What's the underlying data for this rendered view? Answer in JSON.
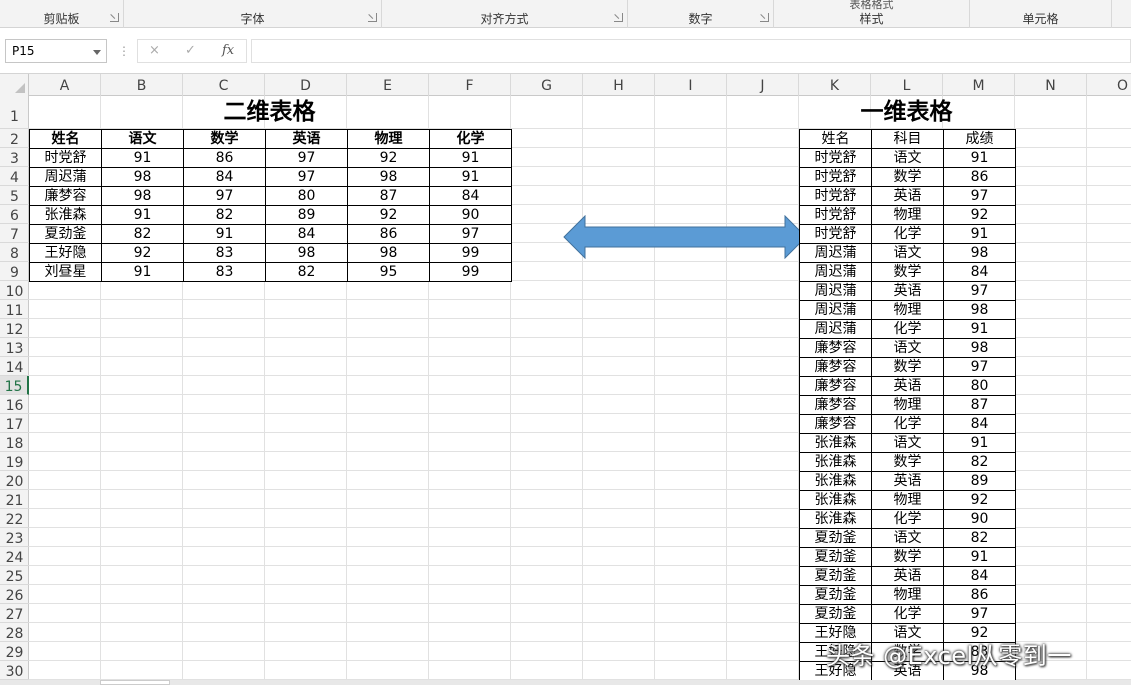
{
  "ribbon": {
    "groups": [
      {
        "label": "剪贴板"
      },
      {
        "label": "字体"
      },
      {
        "label": "对齐方式"
      },
      {
        "label": "数字"
      },
      {
        "label": "样式",
        "clipped_top": "表格格式"
      },
      {
        "label": "单元格"
      }
    ]
  },
  "formula_bar": {
    "name_box": "P15",
    "cancel_icon": "×",
    "enter_icon": "✓",
    "fx_label": "fx",
    "formula_value": ""
  },
  "sheet": {
    "columns": [
      "A",
      "B",
      "C",
      "D",
      "E",
      "F",
      "G",
      "H",
      "I",
      "J",
      "K",
      "L",
      "M",
      "N",
      "O"
    ],
    "rows": [
      "1",
      "2",
      "3",
      "4",
      "5",
      "6",
      "7",
      "8",
      "9",
      "10",
      "11",
      "12",
      "13",
      "14",
      "15",
      "16",
      "17",
      "18",
      "19",
      "20",
      "21",
      "22",
      "23",
      "24",
      "25",
      "26",
      "27",
      "28",
      "29",
      "30"
    ],
    "active_row": "15"
  },
  "table2d": {
    "title": "二维表格",
    "headers": [
      "姓名",
      "语文",
      "数学",
      "英语",
      "物理",
      "化学"
    ],
    "rows": [
      [
        "时党舒",
        "91",
        "86",
        "97",
        "92",
        "91"
      ],
      [
        "周迟蒲",
        "98",
        "84",
        "97",
        "98",
        "91"
      ],
      [
        "廉梦容",
        "98",
        "97",
        "80",
        "87",
        "84"
      ],
      [
        "张淮森",
        "91",
        "82",
        "89",
        "92",
        "90"
      ],
      [
        "夏劲釜",
        "82",
        "91",
        "84",
        "86",
        "97"
      ],
      [
        "王好隐",
        "92",
        "83",
        "98",
        "98",
        "99"
      ],
      [
        "刘昼星",
        "91",
        "83",
        "82",
        "95",
        "99"
      ]
    ]
  },
  "table1d": {
    "title": "一维表格",
    "headers": [
      "姓名",
      "科目",
      "成绩"
    ],
    "rows": [
      [
        "时党舒",
        "语文",
        "91"
      ],
      [
        "时党舒",
        "数学",
        "86"
      ],
      [
        "时党舒",
        "英语",
        "97"
      ],
      [
        "时党舒",
        "物理",
        "92"
      ],
      [
        "时党舒",
        "化学",
        "91"
      ],
      [
        "周迟蒲",
        "语文",
        "98"
      ],
      [
        "周迟蒲",
        "数学",
        "84"
      ],
      [
        "周迟蒲",
        "英语",
        "97"
      ],
      [
        "周迟蒲",
        "物理",
        "98"
      ],
      [
        "周迟蒲",
        "化学",
        "91"
      ],
      [
        "廉梦容",
        "语文",
        "98"
      ],
      [
        "廉梦容",
        "数学",
        "97"
      ],
      [
        "廉梦容",
        "英语",
        "80"
      ],
      [
        "廉梦容",
        "物理",
        "87"
      ],
      [
        "廉梦容",
        "化学",
        "84"
      ],
      [
        "张淮森",
        "语文",
        "91"
      ],
      [
        "张淮森",
        "数学",
        "82"
      ],
      [
        "张淮森",
        "英语",
        "89"
      ],
      [
        "张淮森",
        "物理",
        "92"
      ],
      [
        "张淮森",
        "化学",
        "90"
      ],
      [
        "夏劲釜",
        "语文",
        "82"
      ],
      [
        "夏劲釜",
        "数学",
        "91"
      ],
      [
        "夏劲釜",
        "英语",
        "84"
      ],
      [
        "夏劲釜",
        "物理",
        "86"
      ],
      [
        "夏劲釜",
        "化学",
        "97"
      ],
      [
        "王好隐",
        "语文",
        "92"
      ],
      [
        "王好隐",
        "数学",
        "83"
      ],
      [
        "王好隐",
        "英语",
        "98"
      ]
    ]
  },
  "arrow": {
    "icon": "double-arrow-icon",
    "color": "#5b9bd5"
  },
  "watermark": "头条 @Excel从零到一",
  "colors": {
    "accent": "#217346",
    "grid_line": "#e1e1e1",
    "header_bg": "#f3f3f3"
  }
}
